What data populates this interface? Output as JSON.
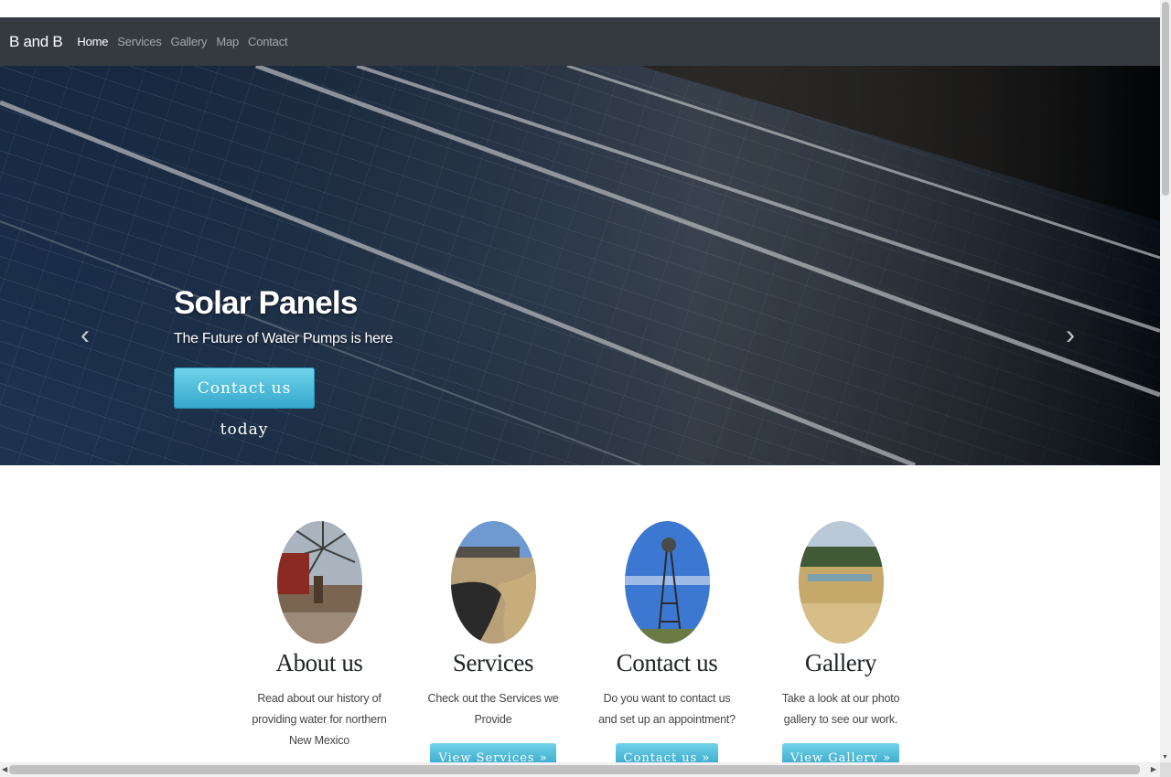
{
  "navbar": {
    "brand": "B and B",
    "links": [
      {
        "label": "Home",
        "active": true
      },
      {
        "label": "Services",
        "active": false
      },
      {
        "label": "Gallery",
        "active": false
      },
      {
        "label": "Map",
        "active": false
      },
      {
        "label": "Contact",
        "active": false
      }
    ]
  },
  "carousel": {
    "prev_icon": "chevron-left",
    "next_icon": "chevron-right",
    "slide": {
      "title": "Solar Panels",
      "subtitle": "The Future of Water Pumps is here",
      "button_label": "Contact us today"
    }
  },
  "cards": [
    {
      "heading": "About us",
      "text": "Read about our history of providing water for northern New Mexico",
      "button": ""
    },
    {
      "heading": "Services",
      "text": "Check out the Services we Provide",
      "button": "View Services »"
    },
    {
      "heading": "Contact us",
      "text": "Do you want to contact us and set up an appointment?",
      "button": "Contact us »"
    },
    {
      "heading": "Gallery",
      "text": "Take a look at our photo gallery to see our work.",
      "button": "View Gallery »"
    }
  ],
  "colors": {
    "navbar_bg": "#343a40",
    "button_accent": "#5bc0de"
  }
}
